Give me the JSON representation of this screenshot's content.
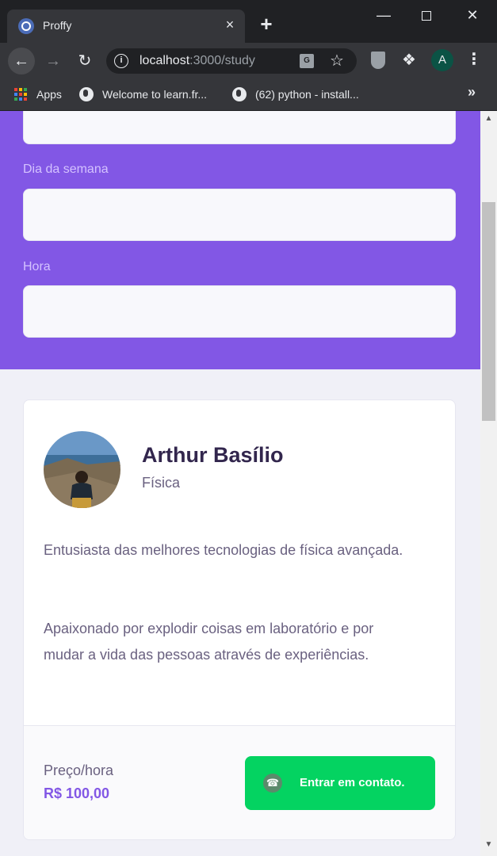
{
  "browser": {
    "tab_title": "Proffy",
    "tab_close": "×",
    "new_tab": "+",
    "url_host": "localhost",
    "url_rest": ":3000/study",
    "bookmarks": [
      {
        "label": "Apps"
      },
      {
        "label": "Welcome to learn.fr..."
      },
      {
        "label": "(62) python - install..."
      }
    ],
    "more_bookmarks": "»",
    "profile_initial": "A"
  },
  "form": {
    "day_label": "Dia da semana",
    "day_value": "",
    "hour_label": "Hora",
    "hour_value": ""
  },
  "teacher": {
    "name": "Arthur Basílio",
    "subject": "Física",
    "bio_1": "Entusiasta das melhores tecnologias de física avançada.",
    "bio_2": "Apaixonado por explodir coisas em laboratório e por mudar a vida das pessoas através de experiências.",
    "price_label": "Preço/hora",
    "price_value": "R$ 100,00",
    "contact_label": "Entrar em contato."
  },
  "colors": {
    "primary": "#8257e5",
    "secondary": "#04d361",
    "background": "#f0f0f7",
    "title": "#32264d"
  }
}
